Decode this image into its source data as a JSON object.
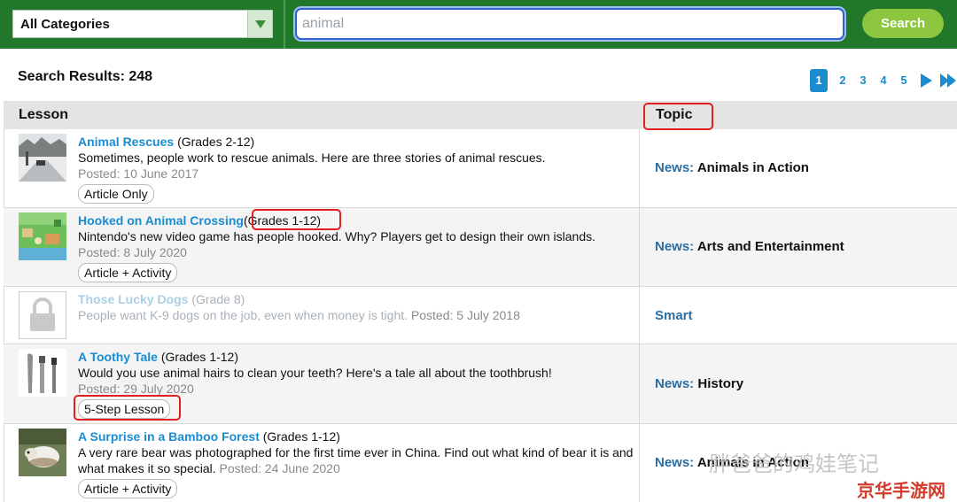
{
  "search_bar": {
    "category_value": "All Categories",
    "query_value": "animal",
    "search_button": "Search"
  },
  "results": {
    "count_label": "Search Results: 248",
    "pages": [
      "1",
      "2",
      "3",
      "4",
      "5"
    ],
    "current_page": "1"
  },
  "table": {
    "col_lesson": "Lesson",
    "col_topic": "Topic",
    "rows": [
      {
        "title": "Animal Rescues",
        "grades": "(Grades 2-12)",
        "description": "Sometimes, people work to rescue animals. Here are three stories of animal rescues.",
        "posted": "Posted: 10 June 2017",
        "tag": "Article Only",
        "topic_category": "News:",
        "topic_name": "Animals in Action"
      },
      {
        "title": "Hooked on Animal Crossing",
        "grades": "(Grades 1-12)",
        "description": "Nintendo's new video game has people hooked. Why? Players get to design their own islands.",
        "posted": "Posted: 8 July 2020",
        "tag": "Article + Activity",
        "topic_category": "News:",
        "topic_name": "Arts and Entertainment"
      },
      {
        "title": "Those Lucky Dogs",
        "grades": "(Grade 8)",
        "description": "People want K-9 dogs on the job, even when money is tight.",
        "posted": "Posted: 5 July 2018",
        "tag": "",
        "topic_category": "Smart",
        "topic_name": ""
      },
      {
        "title": "A Toothy Tale",
        "grades": "(Grades 1-12)",
        "description": "Would you use animal hairs to clean your teeth? Here's a tale all about the toothbrush!",
        "posted": "Posted: 29 July 2020",
        "tag": "5-Step Lesson",
        "topic_category": "News:",
        "topic_name": "History"
      },
      {
        "title": "A Surprise in a Bamboo Forest",
        "grades": "(Grades 1-12)",
        "description": "A very rare bear was photographed for the first time ever in China. Find out what kind of bear it is and what makes it so special.",
        "posted": "Posted: 24 June 2020",
        "tag": "Article + Activity",
        "topic_category": "News:",
        "topic_name": "Animals in Action"
      }
    ]
  },
  "watermark": {
    "text": "胖爸爸的鸡娃笔记",
    "logo": "京华手游网"
  },
  "colors": {
    "header_green": "#22782a",
    "search_button": "#8cc63f",
    "link_blue": "#1a8ccf",
    "highlight_red": "#e0201e"
  }
}
